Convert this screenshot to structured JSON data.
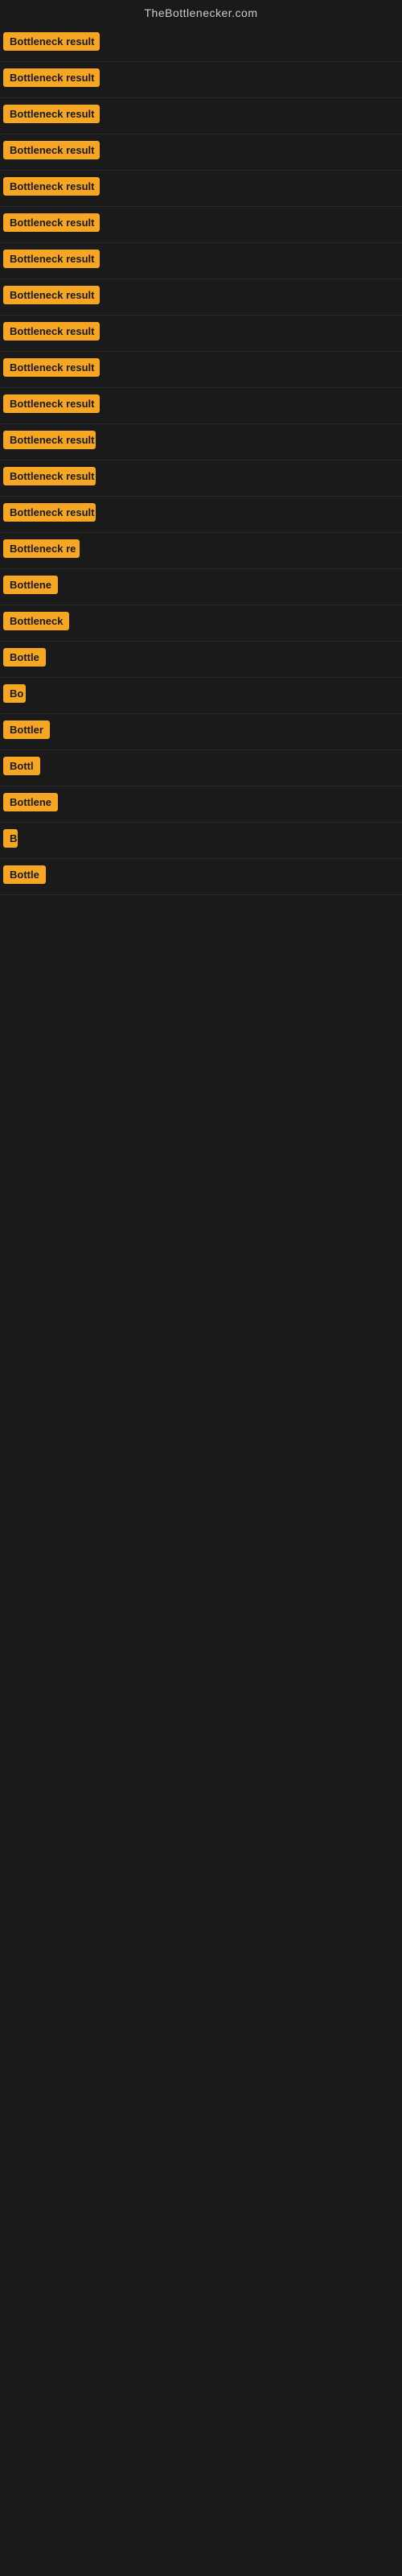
{
  "site": {
    "title": "TheBottlenecker.com"
  },
  "badges": [
    {
      "label": "Bottleneck result",
      "width": 120
    },
    {
      "label": "Bottleneck result",
      "width": 120
    },
    {
      "label": "Bottleneck result",
      "width": 120
    },
    {
      "label": "Bottleneck result",
      "width": 120
    },
    {
      "label": "Bottleneck result",
      "width": 120
    },
    {
      "label": "Bottleneck result",
      "width": 120
    },
    {
      "label": "Bottleneck result",
      "width": 120
    },
    {
      "label": "Bottleneck result",
      "width": 120
    },
    {
      "label": "Bottleneck result",
      "width": 120
    },
    {
      "label": "Bottleneck result",
      "width": 120
    },
    {
      "label": "Bottleneck result",
      "width": 120
    },
    {
      "label": "Bottleneck result",
      "width": 115
    },
    {
      "label": "Bottleneck result",
      "width": 115
    },
    {
      "label": "Bottleneck result",
      "width": 115
    },
    {
      "label": "Bottleneck re",
      "width": 95
    },
    {
      "label": "Bottlene",
      "width": 75
    },
    {
      "label": "Bottleneck",
      "width": 82
    },
    {
      "label": "Bottle",
      "width": 58
    },
    {
      "label": "Bo",
      "width": 28
    },
    {
      "label": "Bottler",
      "width": 62
    },
    {
      "label": "Bottl",
      "width": 50
    },
    {
      "label": "Bottlene",
      "width": 72
    },
    {
      "label": "B",
      "width": 18
    },
    {
      "label": "Bottle",
      "width": 55
    }
  ]
}
